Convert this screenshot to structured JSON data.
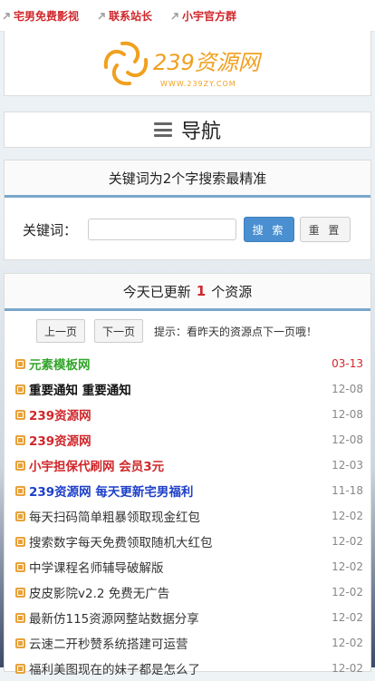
{
  "topbar": {
    "links": [
      "宅男免费影视",
      "联系站长",
      "小宇官方群"
    ]
  },
  "logo": {
    "name": "239资源网",
    "url": "WWW.239ZY.COM",
    "color": "#f0a020"
  },
  "nav": {
    "label": "导航"
  },
  "search": {
    "title": "关键词为2个字搜索最精准",
    "label": "关键词：",
    "placeholder": "",
    "search_btn": "搜 索",
    "reset_btn": "重 置"
  },
  "updates": {
    "prefix": "今天已更新",
    "count": "1",
    "suffix": "个资源",
    "prev": "上一页",
    "next": "下一页",
    "hint": "提示：看昨天的资源点下一页哦！"
  },
  "items": [
    {
      "title": "元素模板网",
      "date": "03-13",
      "style": "green",
      "date_red": true
    },
    {
      "title": "重要通知 重要通知",
      "date": "12-08",
      "style": "black"
    },
    {
      "title": "239资源网",
      "date": "12-08",
      "style": "red"
    },
    {
      "title": "239资源网",
      "date": "12-08",
      "style": "red"
    },
    {
      "title": "小宇担保代刷网 会员3元",
      "date": "12-03",
      "style": "red"
    },
    {
      "title": "239资源网 每天更新宅男福利",
      "date": "11-18",
      "style": "blue"
    },
    {
      "title": "每天扫码简单粗暴领取现金红包",
      "date": "12-02",
      "style": "normal"
    },
    {
      "title": "搜索数字每天免费领取随机大红包",
      "date": "12-02",
      "style": "normal"
    },
    {
      "title": "中学课程名师辅导破解版",
      "date": "12-02",
      "style": "normal"
    },
    {
      "title": "皮皮影院v2.2 免费无广告",
      "date": "12-02",
      "style": "normal"
    },
    {
      "title": "最新仿115资源网整站数据分享",
      "date": "12-02",
      "style": "normal"
    },
    {
      "title": "云速二开秒赞系统搭建可运营",
      "date": "12-02",
      "style": "normal"
    },
    {
      "title": "福利美图现在的妹子都是怎么了",
      "date": "12-02",
      "style": "normal"
    }
  ]
}
